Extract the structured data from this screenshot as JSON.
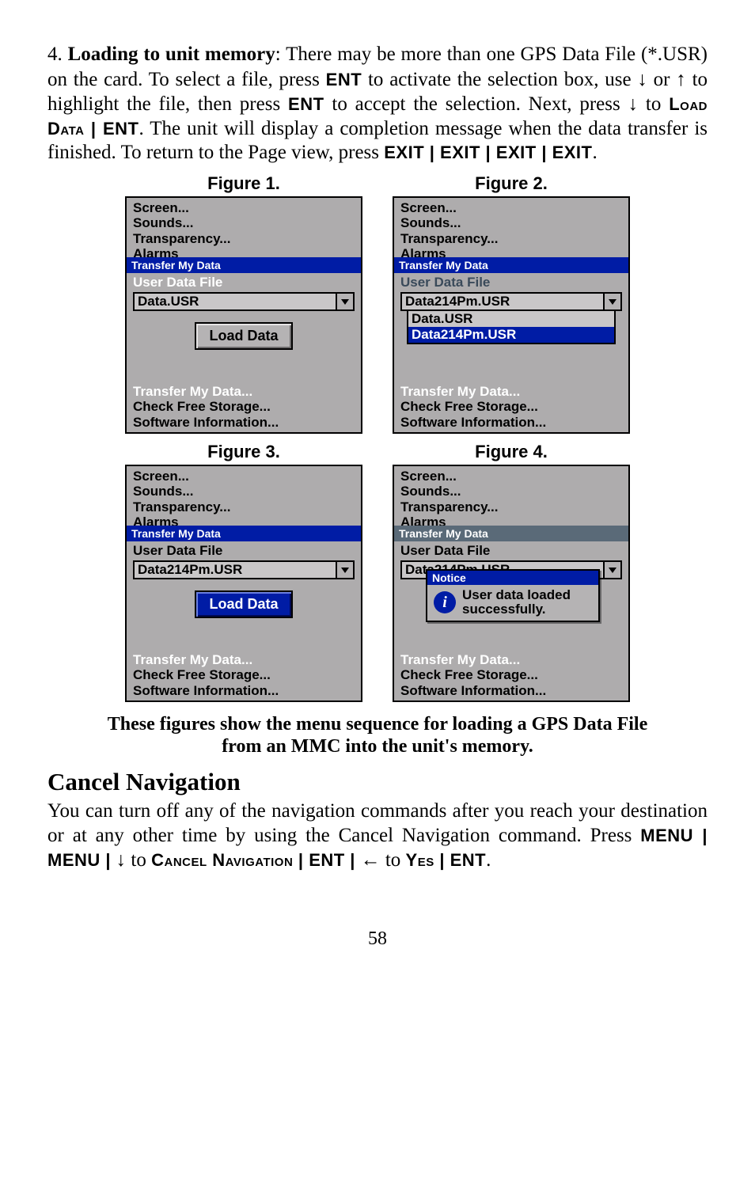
{
  "para1": {
    "lead": "4. ",
    "lead_bold": "Loading to unit memory",
    "t1": ": There may be more than one GPS Data File (*.USR) on the card. To select a file, press ",
    "ENT1": "ENT",
    "t2": " to activate the selection box, use ",
    "down1": "↓",
    "t3": " or ",
    "up1": "↑",
    "t4": " to highlight the file, then press ",
    "ENT2": "ENT",
    "t5": " to accept the selection. Next, press ",
    "down2": "↓",
    "t6": " to ",
    "load_data_sc": "Load Data",
    "t7": " | ",
    "ENT3": "ENT",
    "t8": ". The unit will display a completion message when the data transfer is finished. To return to the Page view, press ",
    "exit_seq": "EXIT | EXIT | EXIT | EXIT",
    "t9": "."
  },
  "figlabels": {
    "f1": "Figure 1.",
    "f2": "Figure 2.",
    "f3": "Figure 3.",
    "f4": "Figure 4."
  },
  "menu_common": {
    "top": [
      "Screen...",
      "Sounds...",
      "Transparency...",
      "Alarms"
    ],
    "titlebar": "Transfer My Data",
    "section": "User Data File",
    "bottom": [
      "Transfer My Data...",
      "Check Free Storage...",
      "Software Information..."
    ]
  },
  "fig1": {
    "combo": "Data.USR",
    "button": "Load Data"
  },
  "fig2": {
    "combo": "Data214Pm.USR",
    "list": [
      "Data.USR",
      "Data214Pm.USR"
    ],
    "hl_index": 1
  },
  "fig3": {
    "combo": "Data214Pm.USR",
    "button": "Load Data"
  },
  "fig4": {
    "combo": "Data214Pm.USR",
    "notice_title": "Notice",
    "notice_line1": "User data loaded",
    "notice_line2": "successfully."
  },
  "caption": {
    "l1": "These figures show the menu sequence for loading a GPS Data File",
    "l2": "from an MMC into the unit's memory."
  },
  "section_heading": "Cancel Navigation",
  "para2": {
    "t1": "You can turn off any of the navigation commands after you reach your destination or at any other time by using the Cancel Navigation command. Press ",
    "menu1": "MENU",
    "sep1": " | ",
    "menu2": "MENU",
    "sep2": " | ",
    "down": "↓",
    "t_to1": " to ",
    "cancel_nav_sc": "Cancel Navigation",
    "sep3": " | ",
    "ent1": "ENT",
    "sep4": " | ",
    "left": "←",
    "t_to2": " to ",
    "yes_sc": "Yes",
    "sep5": " | ",
    "ent2": "ENT",
    "t_end": "."
  },
  "pagenum": "58"
}
